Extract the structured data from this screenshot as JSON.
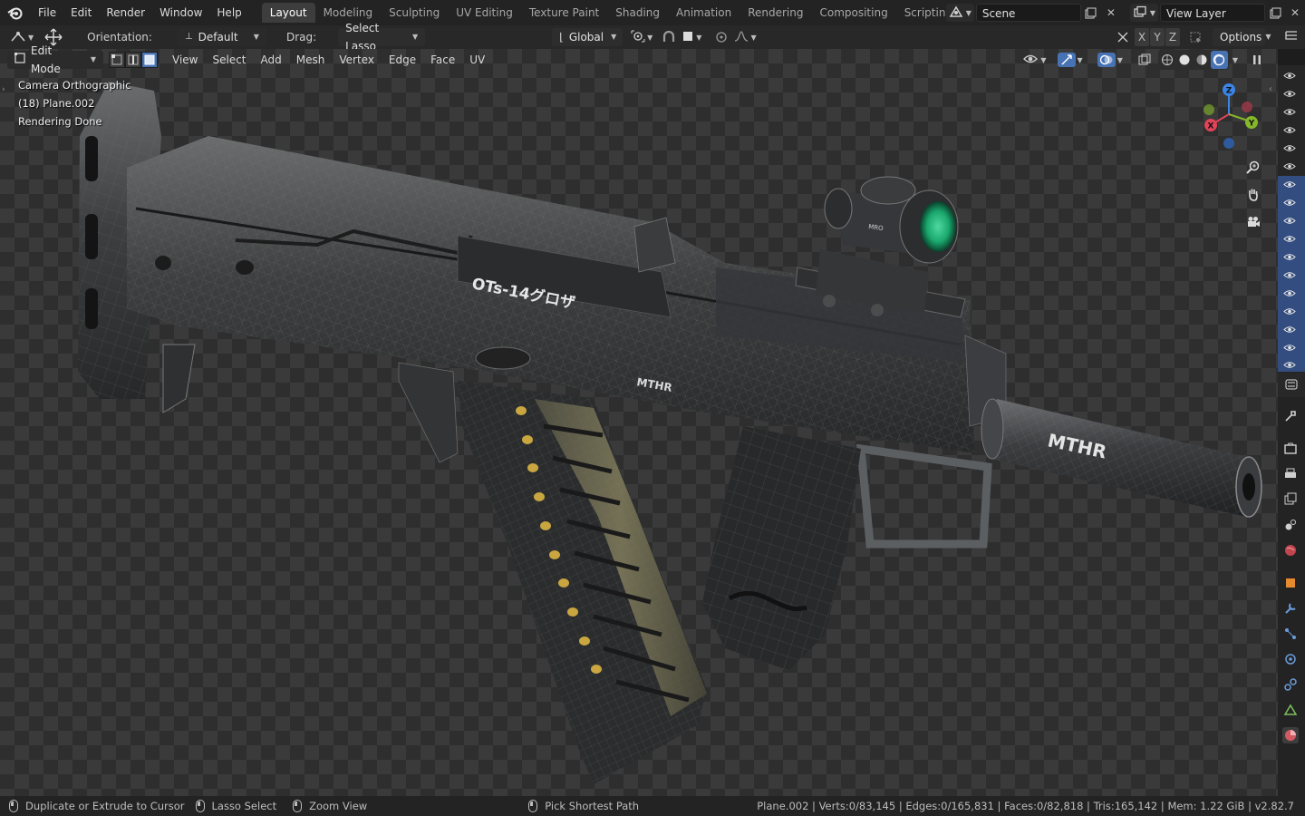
{
  "topbar": {
    "menus": [
      "File",
      "Edit",
      "Render",
      "Window",
      "Help"
    ],
    "workspaces": [
      "Layout",
      "Modeling",
      "Sculpting",
      "UV Editing",
      "Texture Paint",
      "Shading",
      "Animation",
      "Rendering",
      "Compositing",
      "Scripting"
    ],
    "active_workspace": "Layout",
    "add_tab": "+",
    "scene_value": "Scene",
    "view_layer_value": "View Layer"
  },
  "toolheader": {
    "orientation_label": "Orientation:",
    "orientation_value": "Default",
    "drag_label": "Drag:",
    "drag_value": "Select Lasso",
    "transform_orientation": "Global",
    "axes": [
      "X",
      "Y",
      "Z"
    ],
    "options_label": "Options"
  },
  "vpheader": {
    "mode": "Edit Mode",
    "menus": [
      "View",
      "Select",
      "Add",
      "Mesh",
      "Vertex",
      "Edge",
      "Face",
      "UV"
    ],
    "select_mode_active": "face"
  },
  "viewport_info": {
    "camera": "Camera Orthographic",
    "object": "(18) Plane.002",
    "render_status": "Rendering Done"
  },
  "model_labels": {
    "receiver_engraving": "OTs-14グロザ",
    "receiver_brand": "MTHR",
    "suppressor_brand": "MTHR",
    "sight_brand": "MRO"
  },
  "gizmo": {
    "x": "X",
    "y": "Y",
    "z": "Z"
  },
  "statusbar": {
    "hint_left": "Duplicate or Extrude to Cursor",
    "hint_middle": "Lasso Select",
    "hint_right": "Zoom View",
    "hint_extra": "Pick Shortest Path",
    "stats": "Plane.002 | Verts:0/83,145 | Edges:0/165,831 | Faces:0/82,818 | Tris:165,142 | Mem: 1.22 GiB | v2.82.7"
  },
  "colors": {
    "accent": "#4772b3",
    "gizmo_x": "#e24358",
    "gizmo_y": "#86b72b",
    "gizmo_z": "#3b84e6",
    "sight_lens": "#1aa86e"
  }
}
